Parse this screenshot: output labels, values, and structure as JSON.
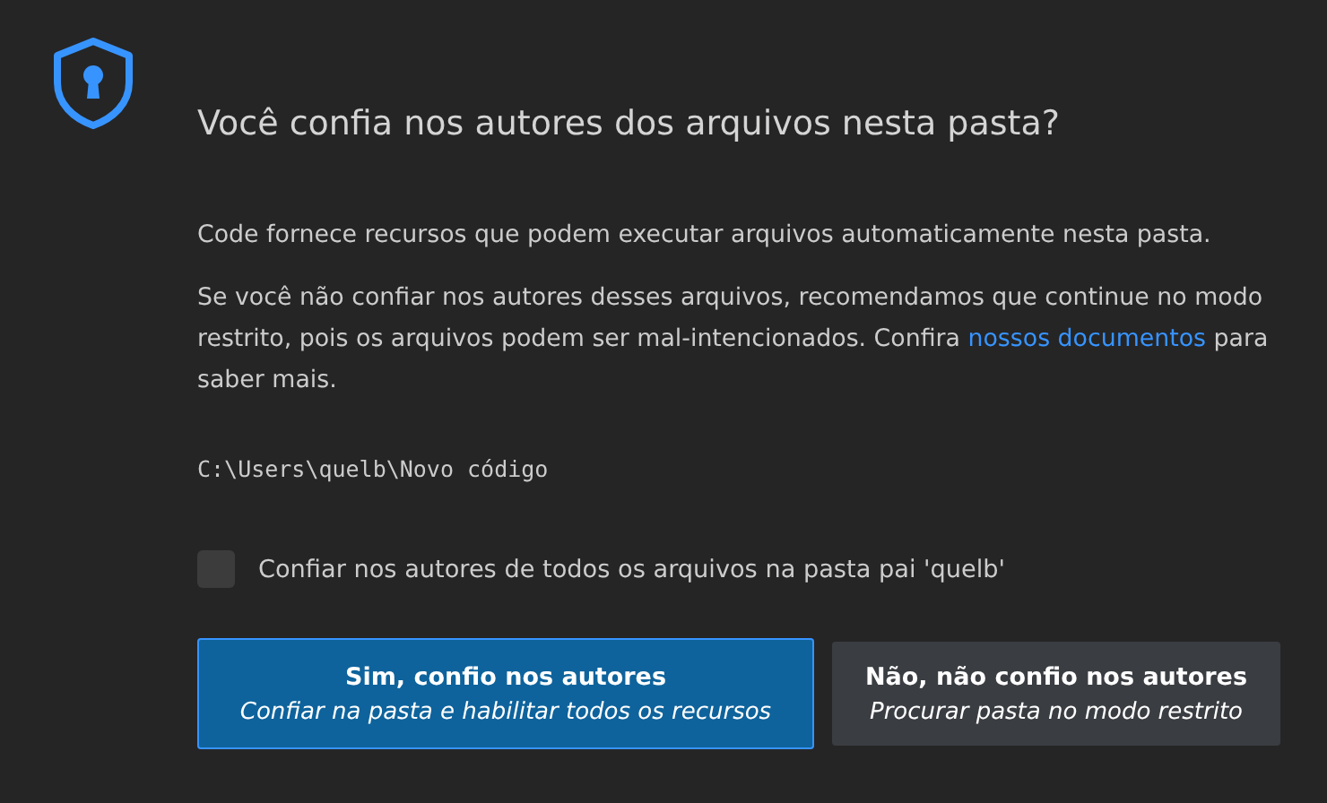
{
  "dialog": {
    "title": "Você confia nos autores dos arquivos nesta pasta?",
    "message": "Code fornece recursos que podem executar arquivos automaticamente nesta pasta.",
    "warning": {
      "text": "Se você não confiar nos autores desses arquivos, recomendamos que continue no modo restrito, pois os arquivos podem ser mal-intencionados. Confira",
      "link": "nossos documentos",
      "text_after": "para saber mais."
    },
    "path": "C:\\Users\\quelb\\Novo código",
    "checkbox": {
      "label": "Confiar nos autores de todos os arquivos na pasta pai 'quelb'",
      "checked": false
    },
    "buttons": [
      {
        "kind": "primary",
        "label": "Sim, confio nos autores",
        "detail": "Confiar na pasta e habilitar todos os recursos"
      },
      {
        "kind": "secondary",
        "label": "Não, não confio nos autores",
        "detail": "Procurar pasta no modo restrito"
      }
    ]
  }
}
